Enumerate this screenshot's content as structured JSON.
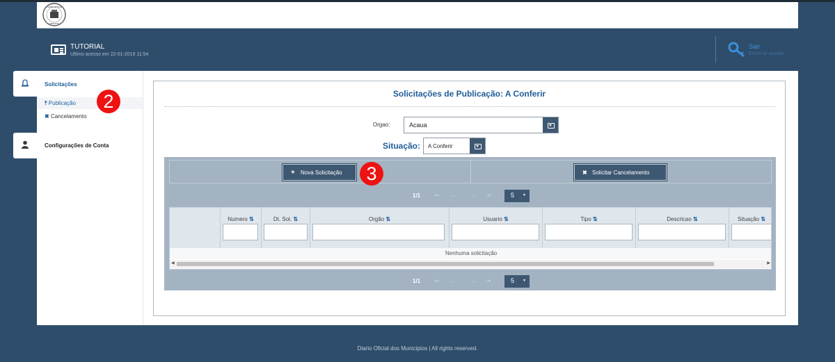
{
  "header": {
    "logo_alt": "Diário Oficial dos Municípios",
    "user_name": "TUTORIAL",
    "last_access": "Ultimo acesso em 22-01-2019 11:54",
    "logout_label": "Sair",
    "logout_sub": "Encerrar sessão"
  },
  "sidebar": {
    "section1_label": "Solicitações",
    "items": [
      {
        "label": "Publicação",
        "icon": "upload-icon"
      },
      {
        "label": "Cancelamento",
        "icon": "x-icon"
      }
    ],
    "section2_label": "Configurações de Conta"
  },
  "annotations": {
    "badge2": "2",
    "badge3": "3"
  },
  "main": {
    "title": "Solicitações de Publicação: A Conferir",
    "orgao_label": "Orgao:",
    "orgao_value": "Acaua",
    "situacao_label": "Situação:",
    "situacao_value": "A Conferir",
    "new_button": "Nova Solicitação",
    "cancel_button": "Solicitar Cancelamento",
    "pager": {
      "page": "1/1",
      "rows": "5"
    },
    "columns": [
      "Numero",
      "Dt. Sol.",
      "Orgão",
      "Usuario",
      "Tipo",
      "Descricao",
      "Situação"
    ],
    "empty_message": "Nenhuma solicitação"
  },
  "footer": "Diario Oficial dos Municipios | All rights reserved.",
  "colors": {
    "accent": "#1e5c97",
    "dark": "#3e5872",
    "badge": "#ee1212"
  }
}
